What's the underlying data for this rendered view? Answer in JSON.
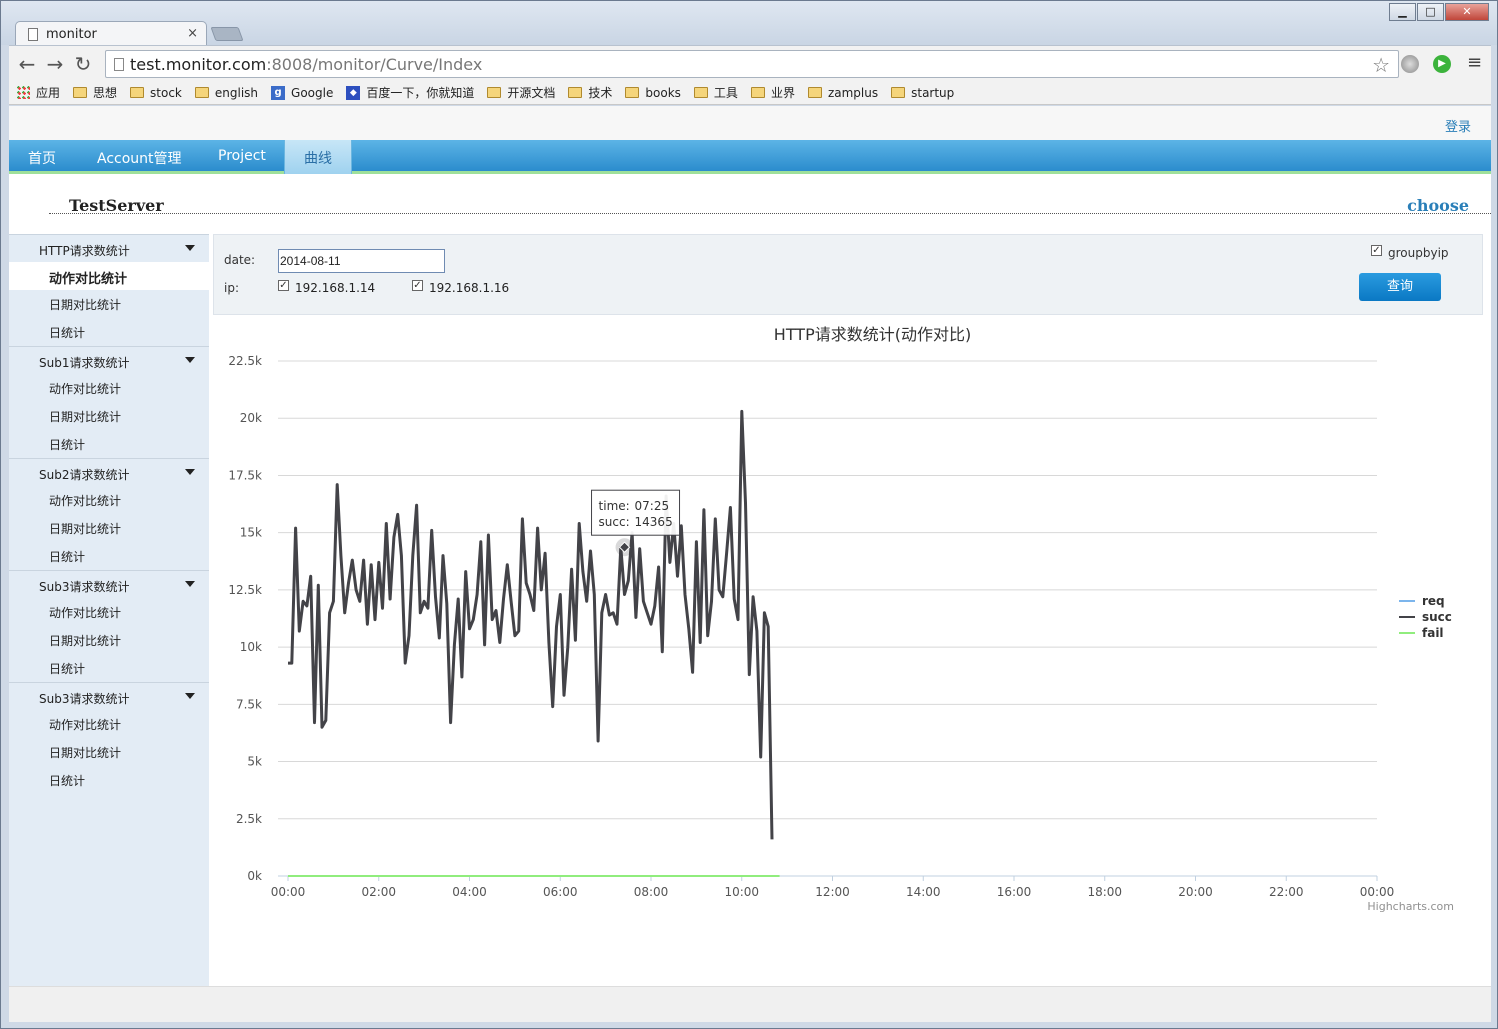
{
  "browser": {
    "tab_title": "monitor",
    "tab_close": "×",
    "url_host": "test.monitor.com",
    "url_rest": ":8008/monitor/Curve/Index",
    "bookmarks": [
      {
        "icon": "apps",
        "label": "应用"
      },
      {
        "icon": "folder",
        "label": "思想"
      },
      {
        "icon": "folder",
        "label": "stock"
      },
      {
        "icon": "folder",
        "label": "english"
      },
      {
        "icon": "google",
        "label": "Google"
      },
      {
        "icon": "baidu",
        "label": "百度一下，你就知道"
      },
      {
        "icon": "folder",
        "label": "开源文档"
      },
      {
        "icon": "folder",
        "label": "技术"
      },
      {
        "icon": "folder",
        "label": "books"
      },
      {
        "icon": "folder",
        "label": "工具"
      },
      {
        "icon": "folder",
        "label": "业界"
      },
      {
        "icon": "folder",
        "label": "zamplus"
      },
      {
        "icon": "folder",
        "label": "startup"
      }
    ]
  },
  "header": {
    "login": "登录",
    "nav": [
      {
        "label": "首页"
      },
      {
        "label": "Account管理"
      },
      {
        "label": "Project"
      },
      {
        "label": "曲线",
        "active": true
      }
    ],
    "server_title": "TestServer",
    "choose": "choose"
  },
  "sidebar": {
    "groups": [
      {
        "label": "HTTP请求数统计",
        "items": [
          "动作对比统计",
          "日期对比统计",
          "日统计"
        ],
        "active_item": 0
      },
      {
        "label": "Sub1请求数统计",
        "items": [
          "动作对比统计",
          "日期对比统计",
          "日统计"
        ]
      },
      {
        "label": "Sub2请求数统计",
        "items": [
          "动作对比统计",
          "日期对比统计",
          "日统计"
        ]
      },
      {
        "label": "Sub3请求数统计",
        "items": [
          "动作对比统计",
          "日期对比统计",
          "日统计"
        ]
      },
      {
        "label": "Sub3请求数统计",
        "items": [
          "动作对比统计",
          "日期对比统计",
          "日统计"
        ]
      }
    ]
  },
  "filter": {
    "date_label": "date:",
    "date_value": "2014-08-11",
    "ip_label": "ip:",
    "ips": [
      {
        "ip": "192.168.1.14",
        "checked": true
      },
      {
        "ip": "192.168.1.16",
        "checked": true
      }
    ],
    "groupbyip_label": "groupbyip",
    "groupbyip_checked": true,
    "query_button": "查询"
  },
  "chart_data": {
    "type": "line",
    "title": "HTTP请求数统计(动作对比)",
    "credits": "Highcharts.com",
    "y_ticks": [
      "0k",
      "2.5k",
      "5k",
      "7.5k",
      "10k",
      "12.5k",
      "15k",
      "17.5k",
      "20k",
      "22.5k"
    ],
    "ylim": [
      0,
      22500
    ],
    "x_ticks": [
      "00:00",
      "02:00",
      "04:00",
      "06:00",
      "08:00",
      "10:00",
      "12:00",
      "14:00",
      "16:00",
      "18:00",
      "20:00",
      "22:00",
      "00:00"
    ],
    "xlim_minutes": [
      0,
      1440
    ],
    "legend_position": "right",
    "grid": true,
    "tooltip": {
      "time_label": "time:",
      "time": "07:25",
      "series_label": "succ:",
      "value": "14365"
    },
    "series": [
      {
        "name": "req",
        "color": "#7cb5ec",
        "values": []
      },
      {
        "name": "succ",
        "color": "#434348",
        "x_minutes": [
          0,
          5,
          10,
          15,
          20,
          25,
          30,
          35,
          40,
          45,
          50,
          55,
          60,
          65,
          70,
          75,
          80,
          85,
          90,
          95,
          100,
          105,
          110,
          115,
          120,
          125,
          130,
          135,
          140,
          145,
          150,
          155,
          160,
          165,
          170,
          175,
          180,
          185,
          190,
          195,
          200,
          205,
          210,
          215,
          220,
          225,
          230,
          235,
          240,
          245,
          250,
          255,
          260,
          265,
          270,
          275,
          280,
          285,
          290,
          295,
          300,
          305,
          310,
          315,
          320,
          325,
          330,
          335,
          340,
          345,
          350,
          355,
          360,
          365,
          370,
          375,
          380,
          385,
          390,
          395,
          400,
          405,
          410,
          415,
          420,
          425,
          430,
          435,
          440,
          445,
          450,
          455,
          460,
          465,
          470,
          475,
          480,
          485,
          490,
          495,
          500,
          505,
          510,
          515,
          520,
          525,
          530,
          535,
          540,
          545,
          550,
          555,
          560,
          565,
          570,
          575,
          580,
          585,
          590,
          595,
          600,
          605,
          610,
          615,
          620,
          625,
          630,
          635,
          640,
          645,
          650
        ],
        "values": [
          9300,
          9300,
          15200,
          10700,
          12000,
          11800,
          13100,
          6700,
          12700,
          6500,
          6800,
          11500,
          12000,
          17100,
          14000,
          11500,
          12800,
          13800,
          12500,
          12000,
          13800,
          11000,
          13600,
          11200,
          13700,
          11700,
          15400,
          12100,
          14800,
          15800,
          14000,
          9300,
          10500,
          14000,
          16200,
          11500,
          12000,
          11700,
          15100,
          12200,
          10400,
          14000,
          11900,
          6700,
          10100,
          12100,
          8700,
          13300,
          10800,
          11200,
          12300,
          14600,
          10100,
          14900,
          11200,
          11600,
          10200,
          12100,
          13600,
          12000,
          10500,
          10700,
          15600,
          12800,
          12300,
          11600,
          15200,
          12500,
          14100,
          10200,
          7400,
          10900,
          12300,
          7900,
          10000,
          13400,
          10300,
          15400,
          13300,
          12000,
          14200,
          12300,
          5900,
          11500,
          12300,
          11400,
          11500,
          11000,
          14365,
          12300,
          12900,
          15000,
          11300,
          14300,
          12000,
          11500,
          11000,
          11800,
          13500,
          9800,
          16600,
          13700,
          15400,
          13100,
          15300,
          12300,
          10800,
          8900,
          14600,
          10200,
          16000,
          10500,
          12000,
          15600,
          12500,
          12200,
          14100,
          16100,
          12100,
          11200,
          20300,
          16300,
          8800,
          12200,
          10700,
          5200,
          11500,
          10900,
          1600
        ],
        "marker": {
          "x_minutes": 445,
          "value": 14365
        }
      },
      {
        "name": "fail",
        "color": "#90ed7d",
        "constant": 0,
        "x_range_minutes": [
          0,
          650
        ]
      }
    ]
  }
}
